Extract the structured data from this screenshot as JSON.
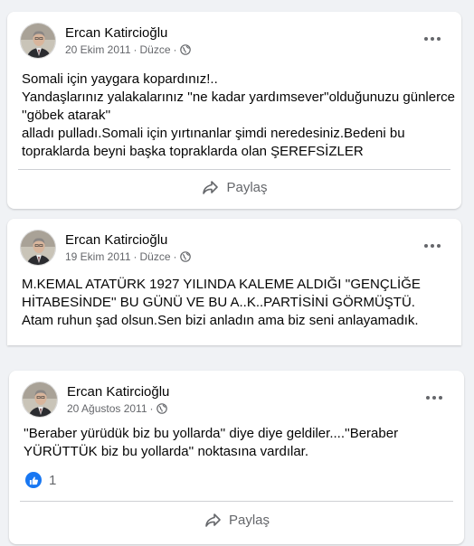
{
  "posts": [
    {
      "author": "Ercan Katircioğlu",
      "date": "20 Ekim 2011",
      "edited": "Düzce",
      "body": "Somali için yaygara kopardınız!..\nYandaşlarınız yalakalarınız ''ne kadar yardımsever''olduğunuzu günlerce ''göbek atarak''\nalladı pulladı.Somali için yırtınanlar şimdi neredesiniz.Bedeni bu topraklarda beyni başka topraklarda olan ŞEREFSİZLER",
      "share_label": "Paylaş"
    },
    {
      "author": "Ercan Katircioğlu",
      "date": "19 Ekim 2011",
      "edited": "Düzce",
      "body": "M.KEMAL ATATÜRK 1927 YILINDA KALEME ALDIĞI ''GENÇLİĞE HİTABESİNDE'' BU GÜNÜ VE BU   A..K..PARTİSİNİ  GÖRMÜŞTÜ. Atam ruhun şad olsun.Sen bizi anladın ama biz seni anlayamadık."
    },
    {
      "author": "Ercan Katircioğlu",
      "date": "20 Ağustos 2011",
      "body": "''Beraber yürüdük biz bu yollarda'' diye diye geldiler....''Beraber YÜRÜTTÜK biz bu yollarda'' noktasına vardılar.",
      "reaction_count": "1",
      "share_label": "Paylaş"
    }
  ],
  "colors": {
    "background": "#f0f2f5",
    "card": "#ffffff",
    "secondary_text": "#65676b",
    "like_blue": "#1877f2"
  },
  "icons": [
    "globe-icon",
    "more-options-icon",
    "share-arrow-icon",
    "like-thumb-icon"
  ]
}
